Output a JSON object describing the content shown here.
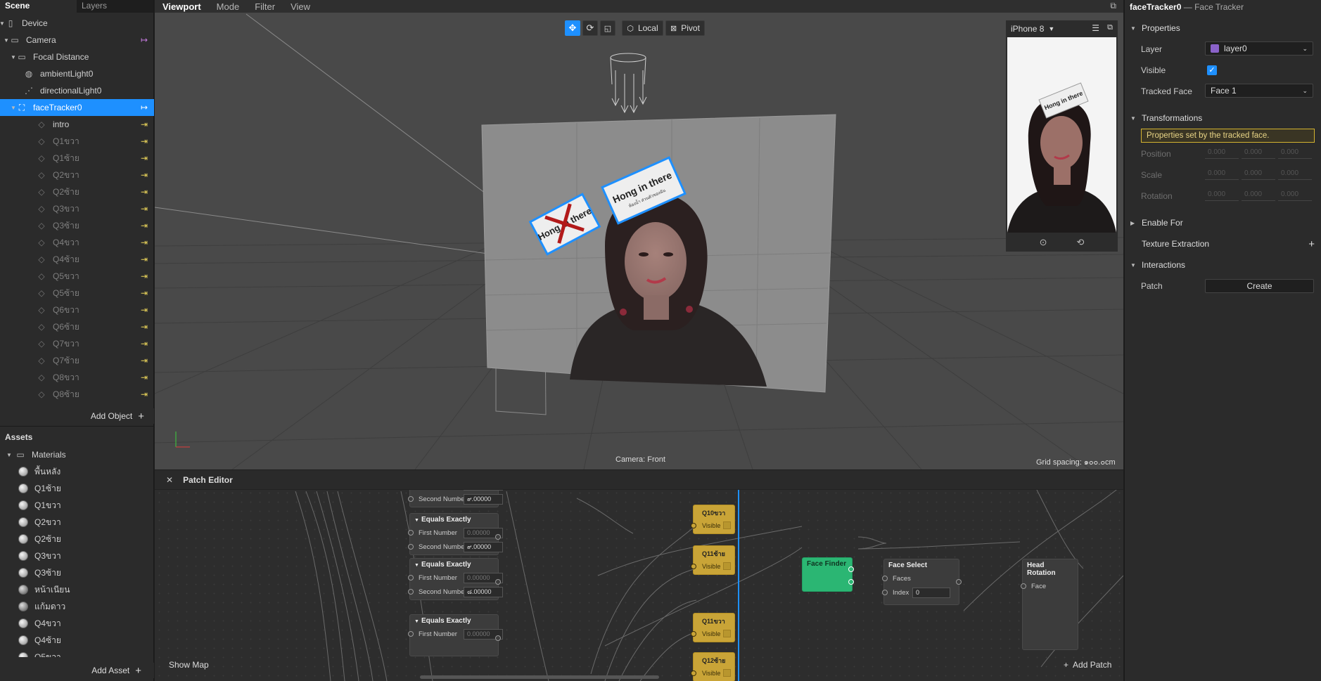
{
  "left_panel": {
    "tabs": [
      "Scene",
      "Layers"
    ],
    "tree": [
      {
        "label": "Device",
        "icon": "device-icon"
      },
      {
        "label": "Camera",
        "icon": "camera-icon"
      },
      {
        "label": "Focal Distance",
        "icon": "focal-distance-icon"
      },
      {
        "label": "ambientLight0",
        "icon": "ambient-light-icon"
      },
      {
        "label": "directionalLight0",
        "icon": "directional-light-icon"
      },
      {
        "label": "faceTracker0",
        "icon": "face-tracker-icon"
      },
      {
        "label": "intro",
        "icon": "plane-icon"
      },
      {
        "label": "Q1ขวา",
        "icon": "plane-icon"
      },
      {
        "label": "Q1ซ้าย",
        "icon": "plane-icon"
      },
      {
        "label": "Q2ขวา",
        "icon": "plane-icon"
      },
      {
        "label": "Q2ซ้าย",
        "icon": "plane-icon"
      },
      {
        "label": "Q3ขวา",
        "icon": "plane-icon"
      },
      {
        "label": "Q3ซ้าย",
        "icon": "plane-icon"
      },
      {
        "label": "Q4ขวา",
        "icon": "plane-icon"
      },
      {
        "label": "Q4ซ้าย",
        "icon": "plane-icon"
      },
      {
        "label": "Q5ขวา",
        "icon": "plane-icon"
      },
      {
        "label": "Q5ซ้าย",
        "icon": "plane-icon"
      },
      {
        "label": "Q6ขวา",
        "icon": "plane-icon"
      },
      {
        "label": "Q6ซ้าย",
        "icon": "plane-icon"
      },
      {
        "label": "Q7ขวา",
        "icon": "plane-icon"
      },
      {
        "label": "Q7ซ้าย",
        "icon": "plane-icon"
      },
      {
        "label": "Q8ขวา",
        "icon": "plane-icon"
      },
      {
        "label": "Q8ซ้าย",
        "icon": "plane-icon"
      }
    ],
    "add_object": "Add Object",
    "assets_title": "Assets",
    "assets": [
      {
        "label": "Materials"
      },
      {
        "label": "พื้นหลัง"
      },
      {
        "label": "Q1ซ้าย"
      },
      {
        "label": "Q1ขวา"
      },
      {
        "label": "Q2ขวา"
      },
      {
        "label": "Q2ซ้าย"
      },
      {
        "label": "Q3ขวา"
      },
      {
        "label": "Q3ซ้าย"
      },
      {
        "label": "หน้าเนียน"
      },
      {
        "label": "แก้มดาว"
      },
      {
        "label": "Q4ขวา"
      },
      {
        "label": "Q4ซ้าย"
      },
      {
        "label": "Q5ขวา"
      }
    ],
    "add_asset": "Add Asset"
  },
  "viewport": {
    "menu": [
      "Viewport",
      "Mode",
      "Filter",
      "View"
    ],
    "toolbar": {
      "local": "Local",
      "pivot": "Pivot"
    },
    "camera_label": "Camera: Front",
    "grid_spacing": "Grid spacing: ๑๐๐.๐cm",
    "sticker_text": "Hong in there",
    "sticker_subtext": "ห้องน้ำ ส่วนตัวของฉัน",
    "device_preview": {
      "device": "iPhone 8"
    }
  },
  "patch_editor": {
    "title": "Patch Editor",
    "show_map": "Show Map",
    "add_patch": "Add Patch",
    "equals_nodes": [
      {
        "title": "",
        "first_label": "First Number",
        "first_value": "0.00000",
        "second_label": "Second Number",
        "second_value": "๙.00000"
      },
      {
        "title": "Equals Exactly",
        "first_label": "First Number",
        "first_value": "0.00000",
        "second_label": "Second Number",
        "second_value": "๙.00000"
      },
      {
        "title": "Equals Exactly",
        "first_label": "First Number",
        "first_value": "0.00000",
        "second_label": "Second Number",
        "second_value": "๘.00000"
      },
      {
        "title": "Equals Exactly",
        "first_label": "First Number",
        "first_value": "0.00000",
        "second_label": "",
        "second_value": ""
      }
    ],
    "visibility_nodes": [
      {
        "title": "Q10ขวา",
        "label": "Visible"
      },
      {
        "title": "Q11ซ้าย",
        "label": "Visible"
      },
      {
        "title": "Q11ขวา",
        "label": "Visible"
      },
      {
        "title": "Q12ซ้าย",
        "label": "Visible"
      }
    ],
    "face_finder": {
      "title": "Face Finder"
    },
    "face_select": {
      "title": "Face Select",
      "faces": "Faces",
      "index_label": "Index",
      "index_value": "0"
    },
    "head_rotation": {
      "title": "Head Rotation",
      "face": "Face"
    }
  },
  "right_panel": {
    "title": "faceTracker0",
    "subtitle": "— Face Tracker",
    "properties": "Properties",
    "layer_label": "Layer",
    "layer_value": "layer0",
    "layer_color": "#8a62c9",
    "visible_label": "Visible",
    "visible_checked": true,
    "tracked_face_label": "Tracked Face",
    "tracked_face_value": "Face 1",
    "transformations": "Transformations",
    "warning": "Properties set by the tracked face.",
    "position": "Position",
    "scale": "Scale",
    "rotation": "Rotation",
    "vector_placeholder": "0.000",
    "enable_for": "Enable For",
    "texture_extraction": "Texture Extraction",
    "interactions": "Interactions",
    "patch_label": "Patch",
    "create_button": "Create"
  },
  "colors": {
    "accent": "#1e90ff",
    "face_finder": "#2bb673",
    "patch_yellow": "#c9a437",
    "warning_border": "#d4b330",
    "arrow_yellow": "#e8d25a",
    "arrow_magenta": "#c77be0"
  }
}
